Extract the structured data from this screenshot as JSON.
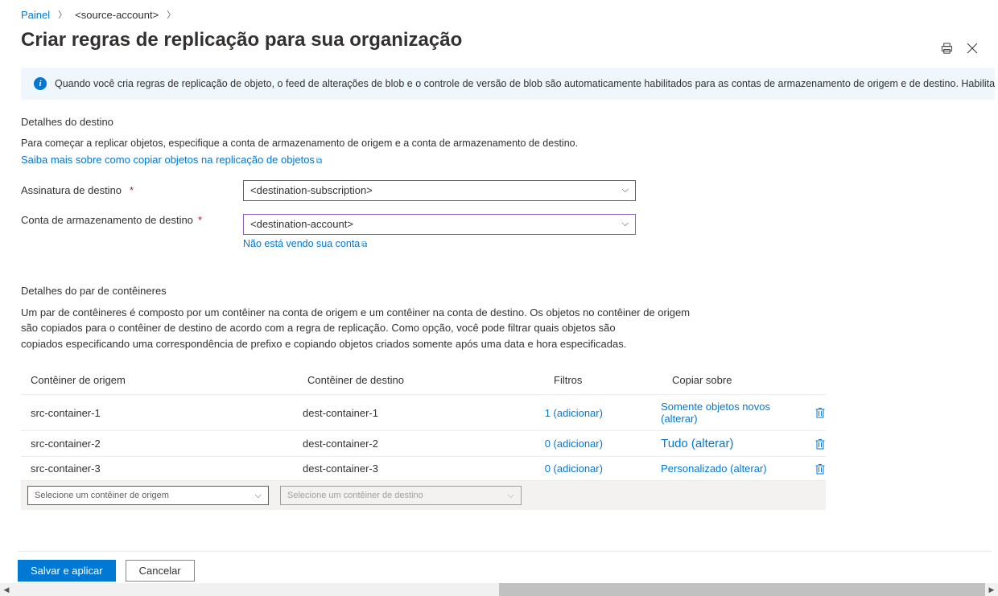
{
  "breadcrumb": {
    "root": "Painel",
    "item": "<source-account>"
  },
  "title": "Criar regras de replicação para sua organização",
  "info_banner": "Quando você cria regras de replicação de objeto, o feed de alterações de blob e o controle de versão de blob são automaticamente habilitados para as contas de armazenamento de origem e de destino. Habilitar es",
  "dest_details": {
    "heading": "Detalhes do destino",
    "desc": "Para começar a replicar objetos, especifique a conta de armazenamento de origem e a conta de armazenamento de destino.",
    "learn_more": "Saiba mais sobre como copiar objetos na replicação de objetos",
    "subscription_label": "Assinatura de destino",
    "subscription_value": "<destination-subscription>",
    "account_label": "Conta de armazenamento de destino",
    "account_value": "<destination-account>",
    "not_seeing": "Não está vendo sua conta"
  },
  "pair_details": {
    "heading": "Detalhes do par de contêineres",
    "desc1": "Um par de contêineres é composto por um contêiner na conta de origem e um contêiner na conta de destino. Os objetos no contêiner de origem",
    "desc2": "são copiados para o contêiner de destino de acordo com a regra de replicação. Como opção, você pode filtrar quais objetos são",
    "desc3": "copiados especificando uma correspondência de prefixo e copiando objetos criados somente após uma data e hora especificadas."
  },
  "grid": {
    "headers": {
      "source": "Contêiner de origem",
      "dest": "Contêiner de destino",
      "filters": "Filtros",
      "copy": "Copiar sobre"
    },
    "rows": [
      {
        "source": "src-container-1",
        "dest": "dest-container-1",
        "filters": "1 (adicionar)",
        "copy": "Somente objetos novos (alterar)"
      },
      {
        "source": "src-container-2",
        "dest": "dest-container-2",
        "filters": "0 (adicionar)",
        "copy": "Tudo (alterar)"
      },
      {
        "source": "src-container-3",
        "dest": "dest-container-3",
        "filters": "0 (adicionar)",
        "copy": "Personalizado (alterar)"
      }
    ],
    "select_source_placeholder": "Selecione um contêiner de origem",
    "select_dest_placeholder": "Selecione um contêiner de destino"
  },
  "footer": {
    "save": "Salvar e aplicar",
    "cancel": "Cancelar"
  }
}
